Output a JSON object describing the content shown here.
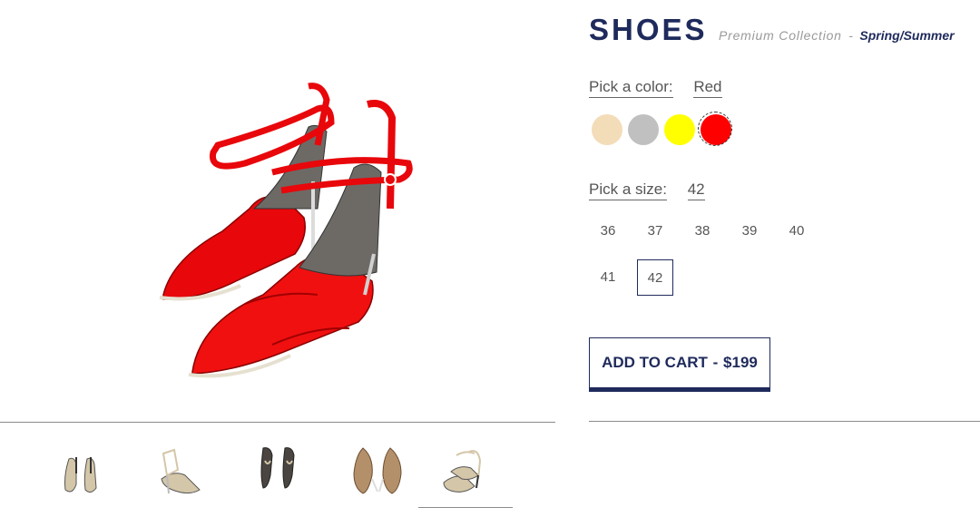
{
  "product": {
    "title": "SHOES",
    "subtitle": "Premium Collection",
    "subtitle_separator": "-",
    "season": "Spring/Summer"
  },
  "color_picker": {
    "label": "Pick a color:",
    "selected_value": "Red",
    "swatches": [
      {
        "name": "beige",
        "hex": "#f3dcb8"
      },
      {
        "name": "gray",
        "hex": "#c0c0c0"
      },
      {
        "name": "yellow",
        "hex": "#ffff00"
      },
      {
        "name": "red",
        "hex": "#ff0000"
      }
    ]
  },
  "size_picker": {
    "label": "Pick a size:",
    "selected_value": "42",
    "sizes": [
      "36",
      "37",
      "38",
      "39",
      "40",
      "41",
      "42"
    ]
  },
  "cart": {
    "label": "ADD TO CART",
    "separator": "-",
    "price": "$199"
  },
  "colors": {
    "brand": "#1f2a5c",
    "shoe_main": "#e8070b",
    "divider": "#8a8a8a"
  },
  "thumbnails": [
    {
      "view": "front-pair"
    },
    {
      "view": "side"
    },
    {
      "view": "top-down"
    },
    {
      "view": "soles"
    },
    {
      "view": "three-quarter",
      "active": true
    }
  ]
}
